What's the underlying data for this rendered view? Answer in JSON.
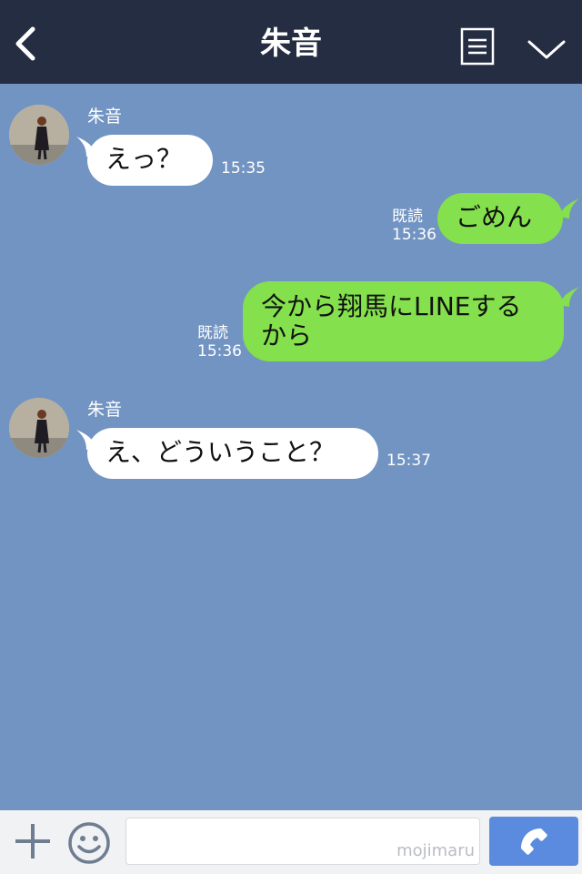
{
  "header": {
    "title": "朱音",
    "icons": {
      "back": "chevron-left-icon",
      "menu": "list-icon",
      "collapse": "chevron-down-icon"
    }
  },
  "colors": {
    "header_bg": "#252d42",
    "chat_bg": "#7294c2",
    "incoming_bubble": "#ffffff",
    "outgoing_bubble": "#84e04c",
    "call_button": "#5b8bdf"
  },
  "messages": [
    {
      "direction": "in",
      "sender": "朱音",
      "text": "えっ？",
      "time": "15:35"
    },
    {
      "direction": "out",
      "read_label": "既読",
      "text": "ごめん",
      "time": "15:36"
    },
    {
      "direction": "out",
      "read_label": "既読",
      "text_lines": [
        "今から翔馬にLINEする",
        "から"
      ],
      "time": "15:36"
    },
    {
      "direction": "in",
      "sender": "朱音",
      "text": "え、どういうこと？",
      "time": "15:37"
    }
  ],
  "footer": {
    "input_value": "",
    "watermark": "mojimaru",
    "icons": {
      "add": "plus-icon",
      "emoji": "smiley-icon",
      "call": "phone-icon"
    }
  }
}
